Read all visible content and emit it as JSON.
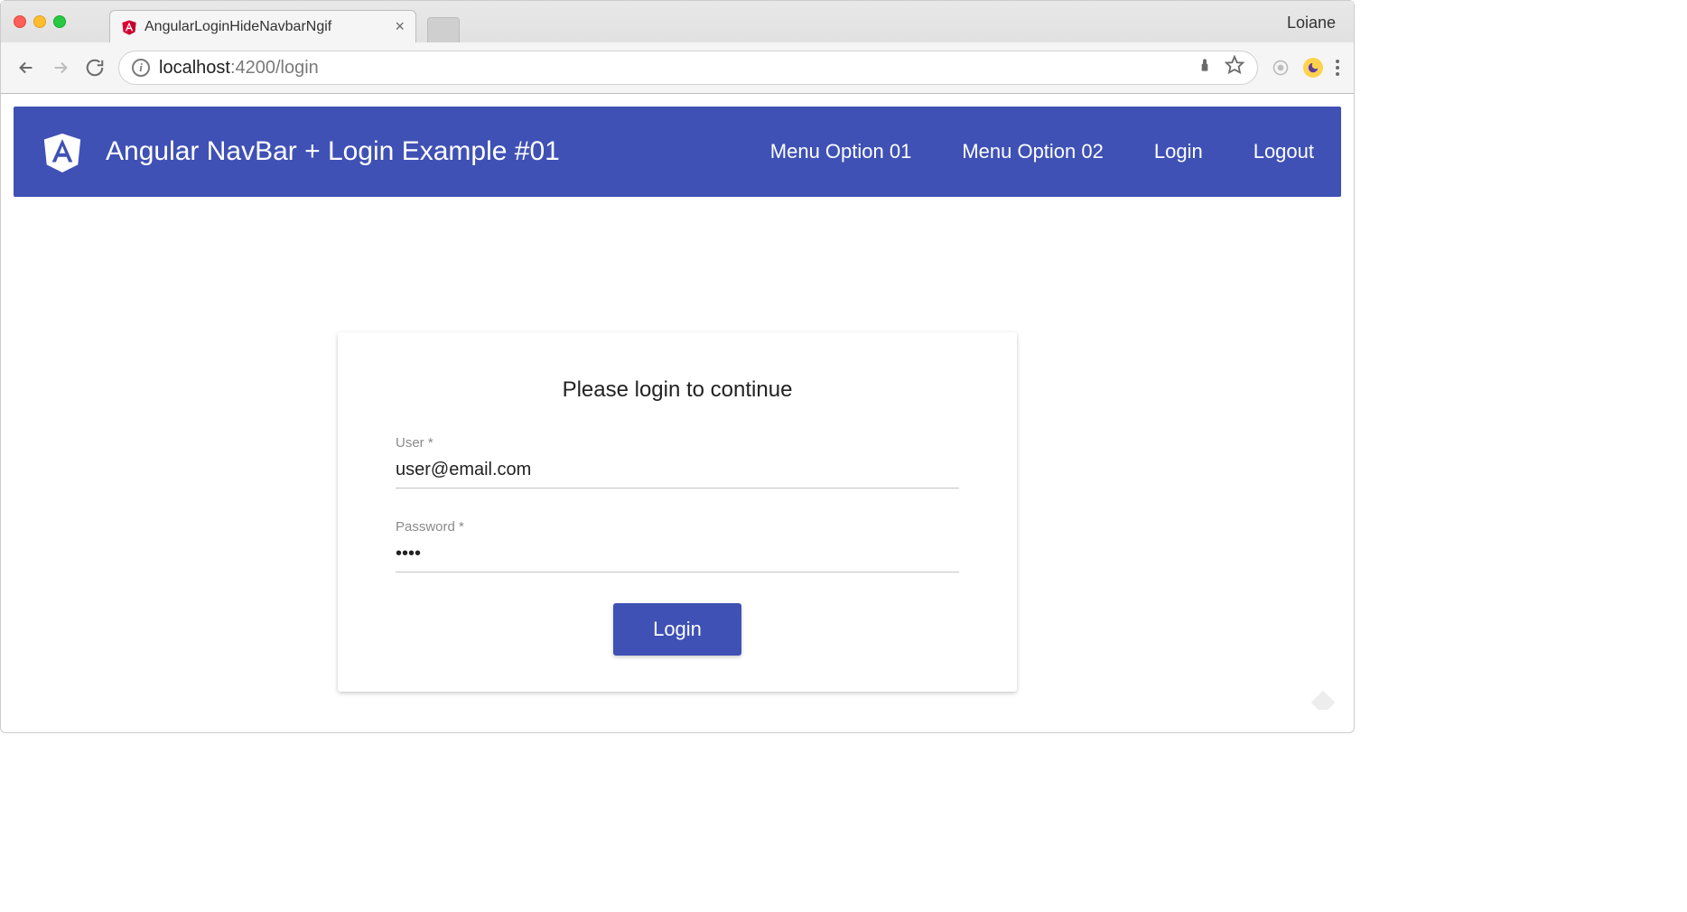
{
  "browser": {
    "tab_title": "AngularLoginHideNavbarNgif",
    "profile_name": "Loiane",
    "url_host": "localhost",
    "url_port_path": ":4200/login"
  },
  "navbar": {
    "title": "Angular NavBar + Login Example #01",
    "menu": {
      "option1": "Menu Option 01",
      "option2": "Menu Option 02",
      "login": "Login",
      "logout": "Logout"
    }
  },
  "login_form": {
    "heading": "Please login to continue",
    "user_label": "User *",
    "user_value": "user@email.com",
    "password_label": "Password *",
    "password_value": "....",
    "submit_label": "Login"
  },
  "colors": {
    "primary": "#3f51b5"
  }
}
